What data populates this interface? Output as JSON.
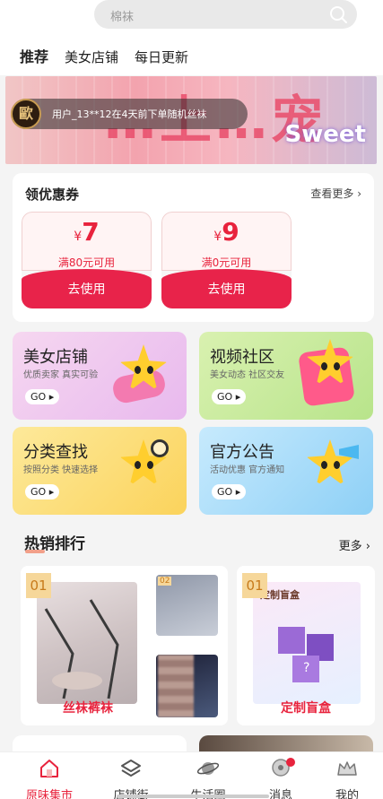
{
  "search": {
    "placeholder": "棉袜"
  },
  "tabs": [
    "推荐",
    "美女店铺",
    "每日更新"
  ],
  "banner": {
    "headline": "…上…宠粉日",
    "sweet": "Sweet",
    "avatar_text": "歐",
    "ticker": "用户_13**12在4天前下单随机丝袜"
  },
  "coupons": {
    "title": "领优惠券",
    "more": "查看更多",
    "currency": "¥",
    "items": [
      {
        "value": "7",
        "condition": "满80元可用",
        "action": "去使用"
      },
      {
        "value": "9",
        "condition": "满0元可用",
        "action": "去使用"
      }
    ]
  },
  "features": [
    {
      "title": "美女店铺",
      "sub": "优质卖家  真实可验",
      "go": "GO"
    },
    {
      "title": "视频社区",
      "sub": "美女动态  社区交友",
      "go": "GO"
    },
    {
      "title": "分类查找",
      "sub": "按照分类  快速选择",
      "go": "GO"
    },
    {
      "title": "官方公告",
      "sub": "活动优惠  官方通知",
      "go": "GO"
    }
  ],
  "hot": {
    "title": "热销排行",
    "more": "更多",
    "panels": [
      {
        "rank": "01",
        "label": "丝袜裤袜",
        "small_rank": "02"
      },
      {
        "rank": "01",
        "label": "定制盲盒",
        "box_text": "定制盲盒"
      }
    ]
  },
  "nav": {
    "items": [
      "原味集市",
      "店铺街",
      "生活圈",
      "消息",
      "我的"
    ]
  },
  "colors": {
    "accent": "#e8233d"
  }
}
